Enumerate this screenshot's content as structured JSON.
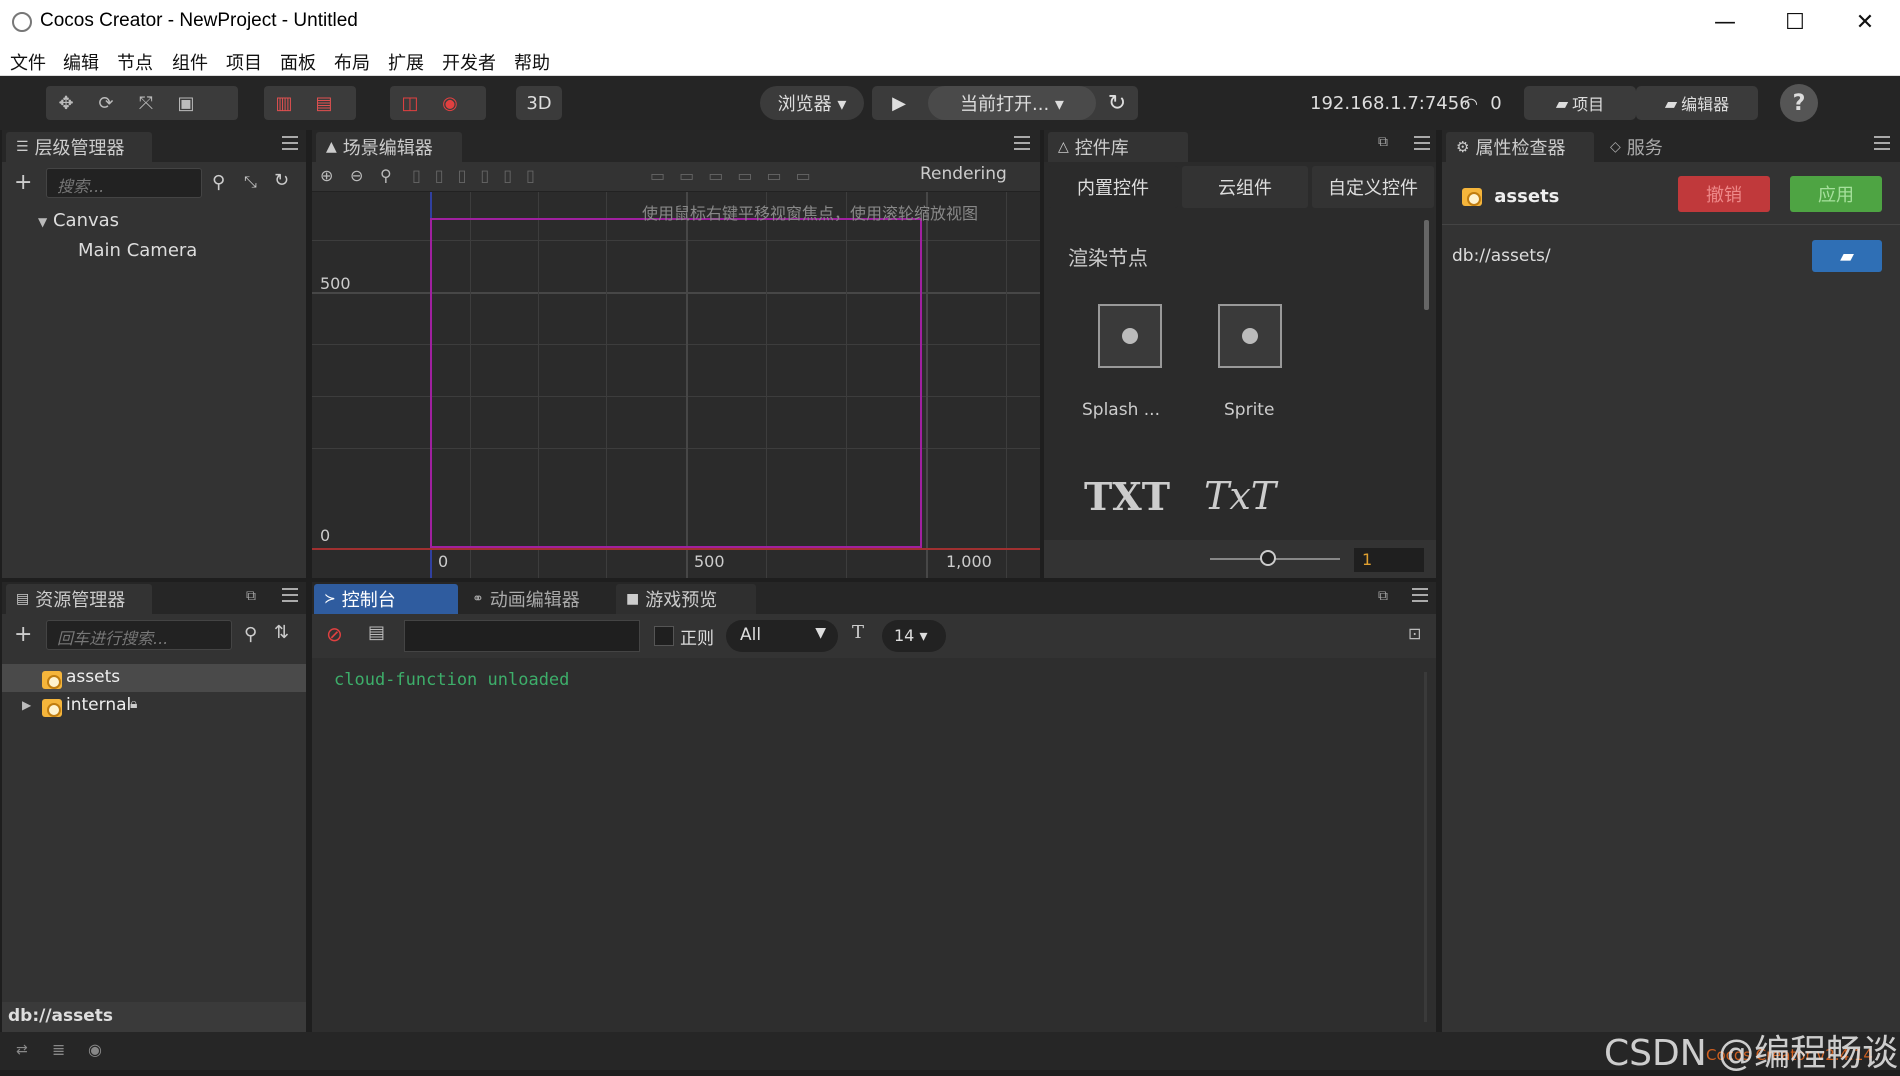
{
  "window": {
    "title": "Cocos Creator - NewProject - Untitled",
    "minimize": "—",
    "maximize": "☐",
    "close": "✕"
  },
  "menu": [
    "文件",
    "编辑",
    "节点",
    "组件",
    "项目",
    "面板",
    "布局",
    "扩展",
    "开发者",
    "帮助"
  ],
  "toolbar": {
    "mode_3d": "3D",
    "platform": "浏览器 ▾",
    "play_icon": "▶",
    "scene_select": "当前打开... ▾",
    "refresh_icon": "↻",
    "ip": "192.168.1.7:7456",
    "connected_count": "0",
    "project_button": "项目",
    "editor_button": "编辑器",
    "help": "?"
  },
  "hierarchy": {
    "tab": "层级管理器",
    "search_placeholder": "搜索...",
    "items": [
      "Canvas",
      "Main Camera"
    ]
  },
  "scene": {
    "tab": "场景编辑器",
    "rendering": "Rendering",
    "hint": "使用鼠标右键平移视窗焦点，使用滚轮缩放视图",
    "y_labels": [
      "500",
      "0"
    ],
    "x_labels": [
      "0",
      "500",
      "1,000"
    ]
  },
  "widgets": {
    "tab": "控件库",
    "subtabs": [
      "内置控件",
      "云组件",
      "自定义控件"
    ],
    "section": "渲染节点",
    "items": [
      "Splash ...",
      "Sprite"
    ],
    "text_items": [
      "TXT",
      "TxT"
    ],
    "zoom_value": "1"
  },
  "inspector": {
    "tab": "属性检查器",
    "tab2": "服务",
    "asset_name": "assets",
    "revert": "撤销",
    "apply": "应用",
    "path": "db://assets/"
  },
  "assets": {
    "tab": "资源管理器",
    "search_placeholder": "回车进行搜索...",
    "items": [
      "assets",
      "internal"
    ],
    "footer": "db://assets"
  },
  "console": {
    "tabs": [
      "控制台",
      "动画编辑器",
      "游戏预览"
    ],
    "regex_label": "正则",
    "level": "All",
    "font_size": "14 ▾",
    "log": "cloud-function unloaded"
  },
  "watermark": {
    "csdn": "CSDN @编程畅谈",
    "version": "Cocos Creator v2.4.14"
  },
  "colors": {
    "accent_blue": "#2f5c9f",
    "revert_red": "#c0393b",
    "apply_green": "#4ea443",
    "canvas_border": "#a020a0",
    "log_green": "#3dae6a"
  }
}
